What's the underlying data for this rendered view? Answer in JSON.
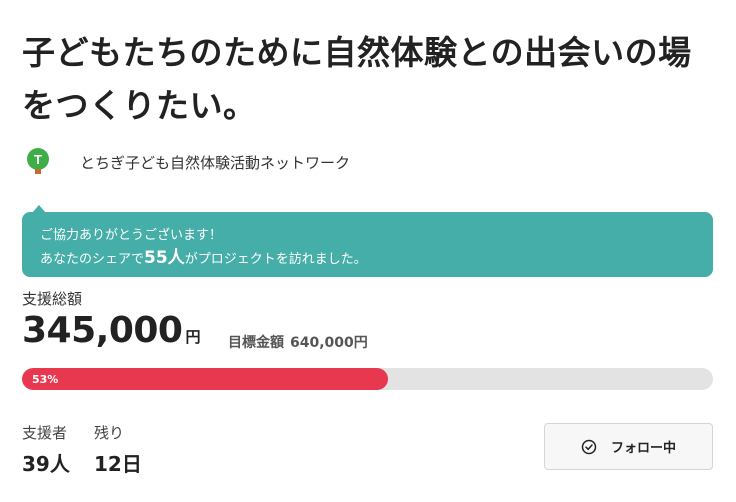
{
  "project": {
    "title": "子どもたちのために自然体験との出会いの場をつくりたい。"
  },
  "organization": {
    "name": "とちぎ子ども自然体験活動ネットワーク",
    "logo_icon": "tree-logo-icon",
    "logo_letter": "T"
  },
  "notice": {
    "line1": "ご協力ありがとうございます！",
    "line2_prefix": "あなたのシェアで",
    "line2_count": "55人",
    "line2_suffix": "がプロジェクトを訪れました。",
    "color": "#46aea8"
  },
  "funding": {
    "total_label": "支援総額",
    "total_amount": "345,000",
    "total_unit": "円",
    "target_label": "目標金額",
    "target_amount": "640,000円",
    "progress_percent": 53,
    "progress_text": "53%",
    "progress_color": "#e8384f"
  },
  "stats": {
    "supporters_label": "支援者",
    "supporters_value": "39人",
    "remaining_label": "残り",
    "remaining_value": "12日"
  },
  "follow_button": {
    "label": "フォロー中",
    "icon": "check-circle-icon"
  }
}
